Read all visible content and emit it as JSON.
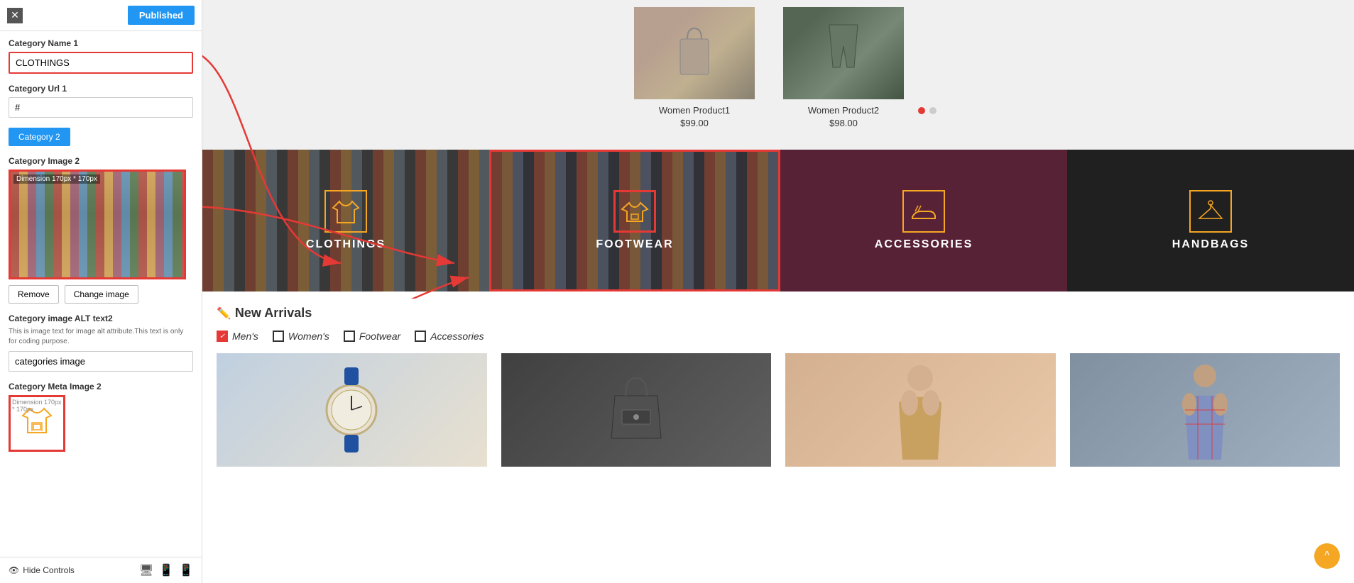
{
  "header": {
    "close_label": "✕",
    "published_label": "Published"
  },
  "panel": {
    "category_name_label": "Category Name 1",
    "category_name_value": "CLOTHINGS",
    "category_url_label": "Category Url 1",
    "category_url_value": "#",
    "category2_button": "Category 2",
    "category_image2_label": "Category Image 2",
    "dimension_label": "Dimension 170px * 170px",
    "remove_btn": "Remove",
    "change_image_btn": "Change image",
    "alt_text_label": "Category image ALT text2",
    "alt_text_note": "This is image text for image alt attribute.This text is only for coding purpose.",
    "alt_text_value": "categories image",
    "meta_image_label": "Category Meta Image 2",
    "meta_dim_label": "Dimension 170px * 170px",
    "hide_controls_label": "Hide Controls"
  },
  "categories": [
    {
      "id": "clothings",
      "label": "CLOTHINGS",
      "icon": "👜",
      "highlighted": false
    },
    {
      "id": "footwear",
      "label": "FOOTWEAR",
      "icon": "👟",
      "highlighted": true
    },
    {
      "id": "accessories",
      "label": "ACCESSORIES",
      "icon": "👟"
    },
    {
      "id": "handbags",
      "label": "HANDBAGS",
      "icon": "🧥"
    }
  ],
  "products": [
    {
      "name": "Women Product1",
      "price": "$99.00"
    },
    {
      "name": "Women Product2",
      "price": "$98.00"
    }
  ],
  "arrivals": {
    "title": "New Arrivals",
    "tabs": [
      {
        "label": "Men's",
        "checked": true
      },
      {
        "label": "Women's",
        "checked": false
      },
      {
        "label": "Footwear",
        "checked": false
      },
      {
        "label": "Accessories",
        "checked": false
      }
    ]
  },
  "scroll_top_label": "^"
}
